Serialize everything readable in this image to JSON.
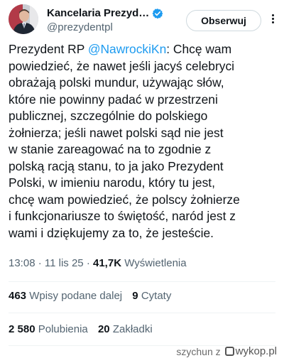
{
  "header": {
    "display_name": "Kancelaria Prezyd…",
    "handle": "@prezydentpl",
    "follow_label": "Obserwuj",
    "verified_color": "#1d9bf0",
    "avatar_icon": "profile-photo"
  },
  "tweet": {
    "lines": [
      {
        "prefix": "Prezydent RP ",
        "mention": "@NawrockiKn",
        "suffix": ": Chcę wam"
      },
      {
        "text": "powiedzieć, że nawet jeśli jacyś celebryci"
      },
      {
        "text": "obrażają polski mundur, używając słów,"
      },
      {
        "text": "które nie powinny padać w przestrzeni"
      },
      {
        "text": "publicznej, szczególnie do polskiego"
      },
      {
        "text": "żołnierza; jeśli nawet polski sąd nie jest"
      },
      {
        "text": "w stanie zareagować na to zgodnie z"
      },
      {
        "text": "polską racją stanu, to ja jako Prezydent"
      },
      {
        "text": "Polski, w imieniu narodu, który tu jest,"
      },
      {
        "text": "chcę wam powiedzieć, że polscy żołnierze"
      },
      {
        "text": "i funkcjonariusze to świętość, naród jest z"
      },
      {
        "text": "wami i dziękujemy za to, że jesteście."
      }
    ],
    "mention_color": "#1d9bf0"
  },
  "meta": {
    "time": "13:08",
    "date": "11 lis 25",
    "views": "41,7K",
    "views_label": "Wyświetlenia",
    "separator": " · "
  },
  "stats": {
    "reposts": {
      "count": "463",
      "label": "Wpisy podane dalej"
    },
    "quotes": {
      "count": "9",
      "label": "Cytaty"
    },
    "likes": {
      "count": "2 580",
      "label": "Polubienia"
    },
    "bookmarks": {
      "count": "20",
      "label": "Zakładki"
    }
  },
  "watermark": {
    "user": "szychun",
    "z": "z",
    "site": "wykop.pl"
  }
}
